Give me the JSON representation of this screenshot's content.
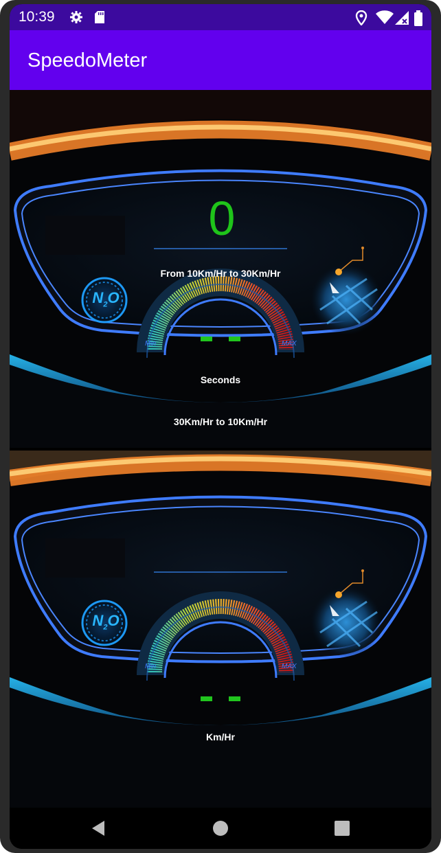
{
  "status_bar": {
    "time": "10:39",
    "icons": [
      "gear-icon",
      "sd-card-icon",
      "location-icon",
      "wifi-icon",
      "cellular-no-data-icon",
      "battery-icon"
    ]
  },
  "app_bar": {
    "title": "SpeedoMeter"
  },
  "panel_top": {
    "value": "0",
    "subtitle": "From 10Km/Hr to 30Km/Hr",
    "unit": "Seconds",
    "secondary_label": "30Km/Hr to 10Km/Hr",
    "gauge_min": "Min",
    "gauge_max": "MAX",
    "badge": "N2O",
    "readout": "- -"
  },
  "panel_bottom": {
    "unit": "Km/Hr",
    "gauge_min": "Min",
    "gauge_max": "MAX",
    "badge": "N2O",
    "readout": "- -"
  },
  "nav_bar": {
    "items": [
      "back",
      "home",
      "recents"
    ]
  },
  "colors": {
    "status_bar": "#3c0a9e",
    "app_bar": "#6200ee",
    "value_green": "#1fc41a",
    "frame_blue": "#3f7cff",
    "glow_orange": "#ff8a2b",
    "glow_cyan": "#1aa8ff"
  }
}
